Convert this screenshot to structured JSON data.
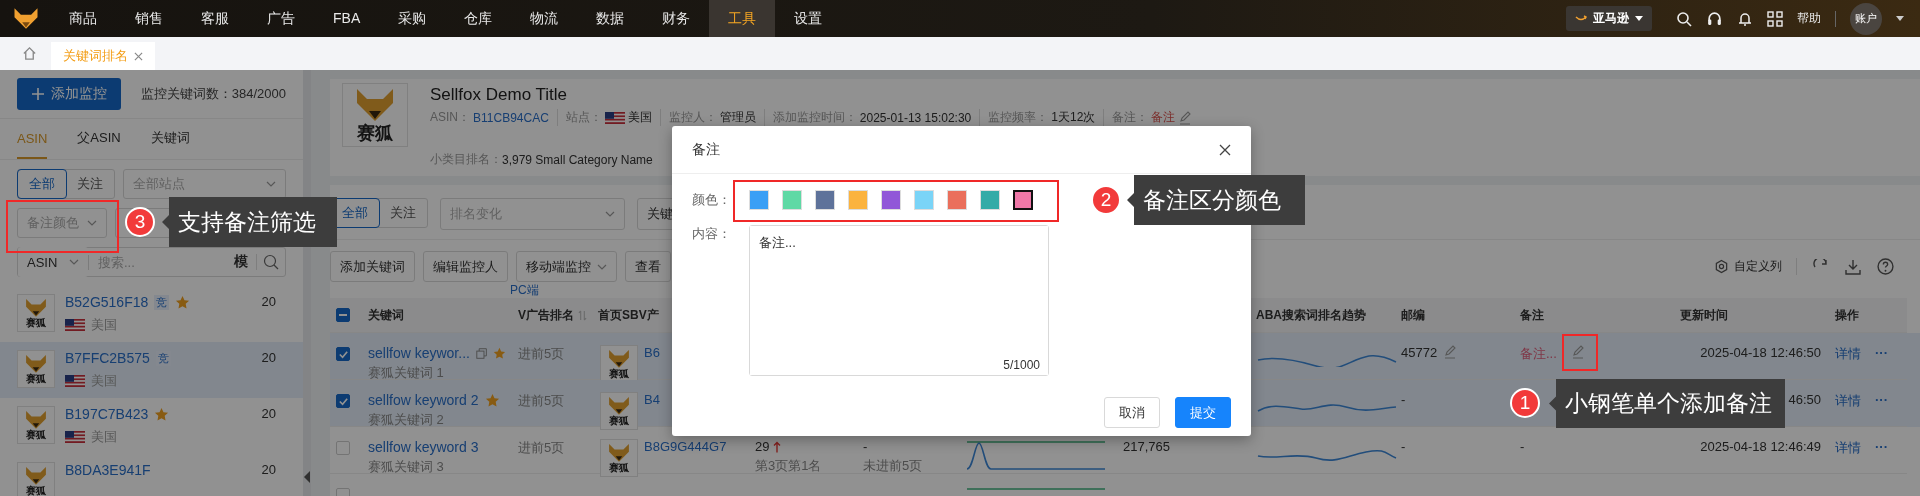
{
  "nav": {
    "items": [
      {
        "label": "商品",
        "selected": false
      },
      {
        "label": "销售",
        "selected": false
      },
      {
        "label": "客服",
        "selected": false
      },
      {
        "label": "广告",
        "selected": false
      },
      {
        "label": "FBA",
        "selected": false
      },
      {
        "label": "采购",
        "selected": false
      },
      {
        "label": "仓库",
        "selected": false
      },
      {
        "label": "物流",
        "selected": false
      },
      {
        "label": "数据",
        "selected": false
      },
      {
        "label": "财务",
        "selected": false
      },
      {
        "label": "工具",
        "selected": true
      },
      {
        "label": "设置",
        "selected": false
      }
    ],
    "marketplace": "亚马逊",
    "help": "帮助",
    "account": "账户"
  },
  "tabs": [
    {
      "label": "关键词排名",
      "selected": true
    }
  ],
  "sidebar": {
    "add_button": "添加监控",
    "quota": "监控关键词数：384/2000",
    "tabs": [
      {
        "label": "ASIN",
        "selected": true
      },
      {
        "label": "父ASIN",
        "selected": false
      },
      {
        "label": "关键词",
        "selected": false
      }
    ],
    "segments": [
      {
        "label": "全部",
        "selected": true
      },
      {
        "label": "关注",
        "selected": false
      }
    ],
    "site_select": "全部站点",
    "note_color_select": "备注颜色",
    "search_type": "ASIN",
    "search_placeholder": "搜索...",
    "search_mode": "模",
    "items": [
      {
        "asin": "B52G516F18",
        "tag": "竞",
        "starred": true,
        "logo_text": "赛狐",
        "country": "美国",
        "count": "20",
        "selected": false
      },
      {
        "asin": "B7FFC2B575",
        "tag": "竞",
        "starred": false,
        "logo_text": "赛狐",
        "country": "美国",
        "count": "20",
        "selected": true
      },
      {
        "asin": "B197C7B423",
        "starred": true,
        "logo_text": "赛狐",
        "country": "美国",
        "count": "20",
        "selected": false
      },
      {
        "asin": "B8DA3E941F",
        "starred": false,
        "logo_text": "赛狐",
        "count": "20",
        "selected": false
      }
    ]
  },
  "product": {
    "logo_text": "赛狐",
    "title": "Sellfox Demo Title",
    "info": [
      {
        "label": "ASIN：",
        "value": "B11CB94CAC",
        "kind": "link"
      },
      {
        "label": "站点：",
        "value": "美国",
        "kind": "flag"
      },
      {
        "label": "监控人：",
        "value": "管理员",
        "kind": "text"
      },
      {
        "label": "添加监控时间：",
        "value": "2025-01-13 15:02:30",
        "kind": "text"
      },
      {
        "label": "监控频率：",
        "value": "1天12次",
        "kind": "text"
      },
      {
        "label": "备注：",
        "value": "备注",
        "kind": "note"
      }
    ],
    "category_label": "小类目排名：",
    "category_value": "3,979 Small Category Name"
  },
  "toolbar": {
    "segments": [
      {
        "label": "全部",
        "selected": true
      },
      {
        "label": "关注",
        "selected": false
      }
    ],
    "rank_change_select": "排名变化",
    "keyword_select": "关键",
    "buttons": [
      {
        "label": "添加关键词",
        "kind": "plain"
      },
      {
        "label": "编辑监控人",
        "kind": "plain"
      },
      {
        "label": "移动端监控",
        "kind": "dropdown"
      },
      {
        "label": "查看",
        "kind": "plain"
      }
    ],
    "custom_columns": "自定义列"
  },
  "table": {
    "group_label": "PC端",
    "select_all": {
      "indeterminate": true
    },
    "columns": [
      "关键词",
      "V广告排名",
      "首页SBV产",
      "ABA搜索词排名趋势",
      "邮编",
      "备注",
      "更新时间",
      "操作"
    ],
    "rows": [
      {
        "checked": true,
        "hovered": true,
        "starred": true,
        "keyword": "sellfow keywor...",
        "keyword_cn": "赛狐关键词 1",
        "ad_rank": "进前5页",
        "logo_text": "赛狐",
        "sbv_asin": "B6",
        "postcode": "45772",
        "note": "备注...",
        "note_tagged": true,
        "time": "2025-04-18 12:46:50",
        "action": "详情",
        "more": "···"
      },
      {
        "checked": true,
        "hovered": false,
        "starred": true,
        "keyword": "sellfow keyword 2",
        "keyword_cn": "赛狐关键词 2",
        "ad_rank": "进前5页",
        "logo_text": "赛狐",
        "sbv_asin": "B4",
        "postcode": "-",
        "time": "46:50",
        "action": "详情",
        "more": "···"
      },
      {
        "checked": false,
        "hovered": false,
        "starred": false,
        "keyword": "sellfow keyword 3",
        "keyword_cn": "赛狐关键词 3",
        "ad_rank": "进前5页",
        "logo_text": "赛狐",
        "sbv_asin": "B8G9G444G7",
        "rank": "29",
        "rank_up": true,
        "rank_sub": "第3页第1名",
        "sbv_rank": "-",
        "sbv_rank_sub": "未进前5页",
        "search_volume": "217,765",
        "postcode": "-",
        "note": "-",
        "note_tagged": false,
        "time": "2025-04-18 12:46:49",
        "action": "详情",
        "more": "···"
      },
      {
        "checked": false,
        "hovered": false,
        "starred": false
      }
    ]
  },
  "dialog": {
    "title": "备注",
    "color_label": "颜色：",
    "colors": [
      {
        "color": "#3a9ff5",
        "selected": false
      },
      {
        "color": "#5fd9a5",
        "selected": false
      },
      {
        "color": "#5e729a",
        "selected": false
      },
      {
        "color": "#fbb33f",
        "selected": false
      },
      {
        "color": "#9157d8",
        "selected": false
      },
      {
        "color": "#7ad4f7",
        "selected": false
      },
      {
        "color": "#ea6f5c",
        "selected": false
      },
      {
        "color": "#33aba7",
        "selected": false
      },
      {
        "color": "#ef78a8",
        "selected": true
      }
    ],
    "content_label": "内容：",
    "content": "备注...",
    "counter": "5/1000",
    "buttons": [
      {
        "label": "取消",
        "kind": "default"
      },
      {
        "label": "提交",
        "kind": "primary"
      }
    ]
  },
  "annotations": [
    {
      "number": "3",
      "text": "支持备注筛选"
    },
    {
      "number": "2",
      "text": "备注区分颜色"
    },
    {
      "number": "1",
      "text": "小钢笔单个添加备注"
    }
  ]
}
